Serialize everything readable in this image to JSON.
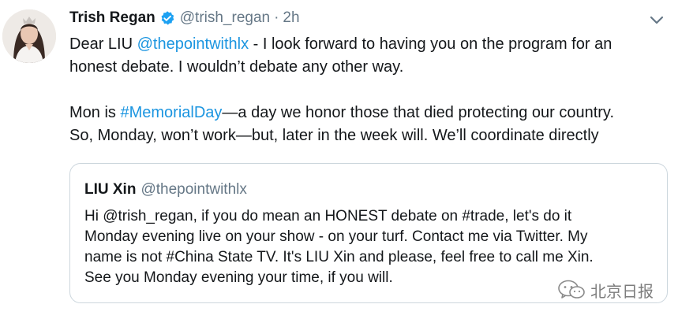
{
  "tweet": {
    "author_name": "Trish Regan",
    "author_handle": "@trish_regan",
    "separator": "·",
    "time": "2h",
    "lines": [
      {
        "pre": "Dear LIU ",
        "link": "@thepointwithlx",
        "post": " - I look forward to having you on the program for an"
      },
      {
        "text": "honest debate. I wouldn’t debate any other way."
      },
      {
        "pre": "Mon is ",
        "link": "#MemorialDay",
        "post": "—a day we honor those that died protecting our country."
      },
      {
        "text": "So, Monday, won’t work—but, later in the week will. We’ll coordinate directly"
      }
    ]
  },
  "quoted_tweet": {
    "author_name": "LIU Xin",
    "author_handle": "@thepointwithlx",
    "lines": [
      "Hi @trish_regan, if you do mean an HONEST debate on #trade, let's do it",
      "Monday evening live on your show - on your turf. Contact me via Twitter.  My",
      "name is not #China State TV. It's LIU Xin and please, feel free to call me Xin.",
      "See you Monday evening your time, if you will."
    ]
  },
  "watermark": {
    "text": "北京日报",
    "icon": "wechat-icon"
  },
  "icons": {
    "verified": "verified-badge-icon",
    "menu": "chevron-down-icon"
  },
  "colors": {
    "link": "#1b95e0",
    "secondary_text": "#657786",
    "border": "#ccd6dd",
    "verified": "#1da1f2"
  }
}
